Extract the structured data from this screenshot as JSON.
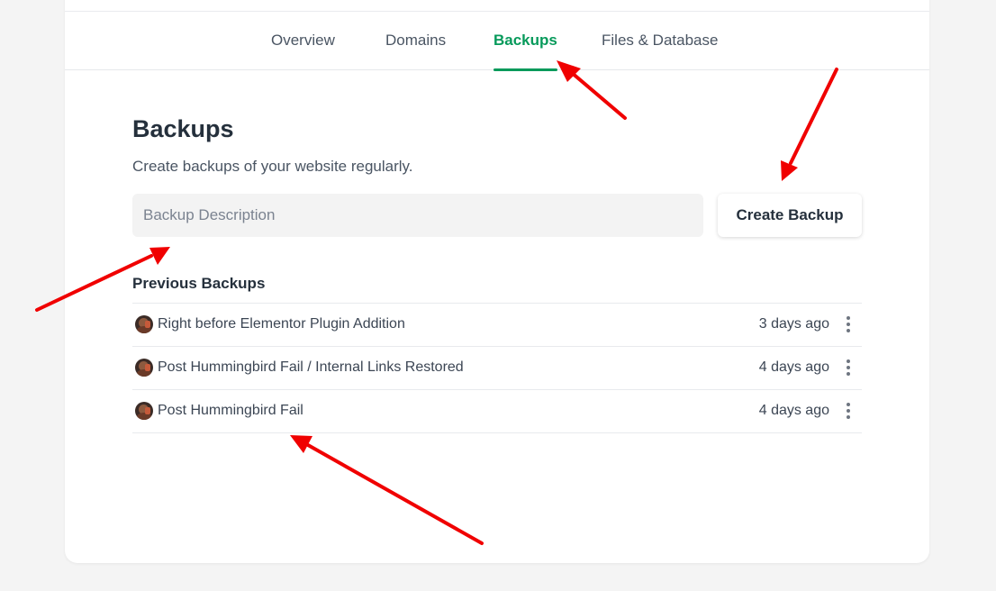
{
  "tabs": [
    {
      "label": "Overview",
      "active": false
    },
    {
      "label": "Domains",
      "active": false
    },
    {
      "label": "Backups",
      "active": true
    },
    {
      "label": "Files & Database",
      "active": false
    }
  ],
  "section": {
    "title": "Backups",
    "subtitle": "Create backups of your website regularly."
  },
  "form": {
    "description_placeholder": "Backup Description",
    "description_value": "",
    "create_button_label": "Create Backup"
  },
  "previous": {
    "title": "Previous Backups",
    "items": [
      {
        "name": "Right before Elementor Plugin Addition",
        "time": "3 days ago",
        "avatar_icon": "user-avatar-icon",
        "menu_icon": "kebab-menu-icon"
      },
      {
        "name": "Post Hummingbird Fail / Internal Links Restored",
        "time": "4 days ago",
        "avatar_icon": "user-avatar-icon",
        "menu_icon": "kebab-menu-icon"
      },
      {
        "name": "Post Hummingbird Fail",
        "time": "4 days ago",
        "avatar_icon": "user-avatar-icon",
        "menu_icon": "kebab-menu-icon"
      }
    ]
  },
  "colors": {
    "accent": "#079a5b",
    "annotation_arrow": "#f00000",
    "page_background": "#f4f4f4"
  }
}
